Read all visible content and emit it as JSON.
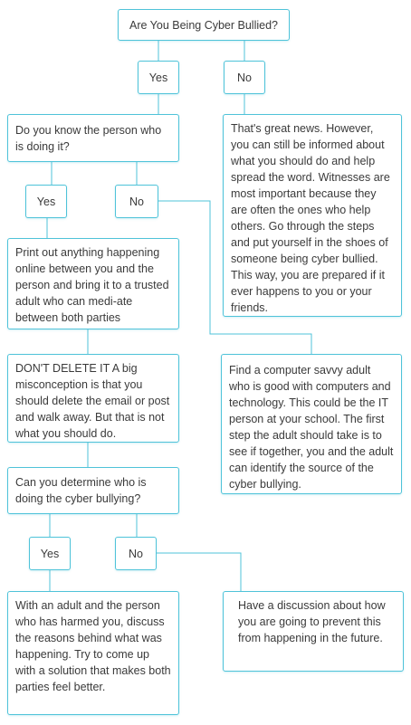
{
  "title": "Are You Being Cyber Bullied?",
  "q1": {
    "yes": "Yes",
    "no": "No"
  },
  "know_person": "Do you know the person who is doing it?",
  "great_news": "That's great news. However, you can still be informed about what you should do and help spread the word. Witnesses are most important because they are often the ones who help others. Go through the steps and put yourself in the shoes of someone being cyber bullied. This way, you are prepared if it ever happens to you or your friends.",
  "q2": {
    "yes": "Yes",
    "no": "No"
  },
  "print_out": "Print out anything happening online between you and the person and bring it to a trusted adult who can medi-ate between both parties",
  "dont_delete": "DON'T DELETE IT A big misconception is that you should delete the email or post and walk away. But that is not what you should do.",
  "tech_adult": "Find a computer savvy adult who is good with computers and technology. This could be the IT person at your school. The first step the adult should take is to see if together, you and the adult can identify the source of the cyber bullying.",
  "determine": "Can you determine who is doing the cyber bullying?",
  "q3": {
    "yes": "Yes",
    "no": "No"
  },
  "with_adult": "With an adult and the person who has harmed you, discuss the reasons behind what was happening. Try to come up with a solution that makes both parties feel better.",
  "discussion": "Have a discussion about how you are going to prevent this from happening in the future.",
  "colors": {
    "border": "#4fc3d9",
    "text": "#3a3a3a"
  }
}
